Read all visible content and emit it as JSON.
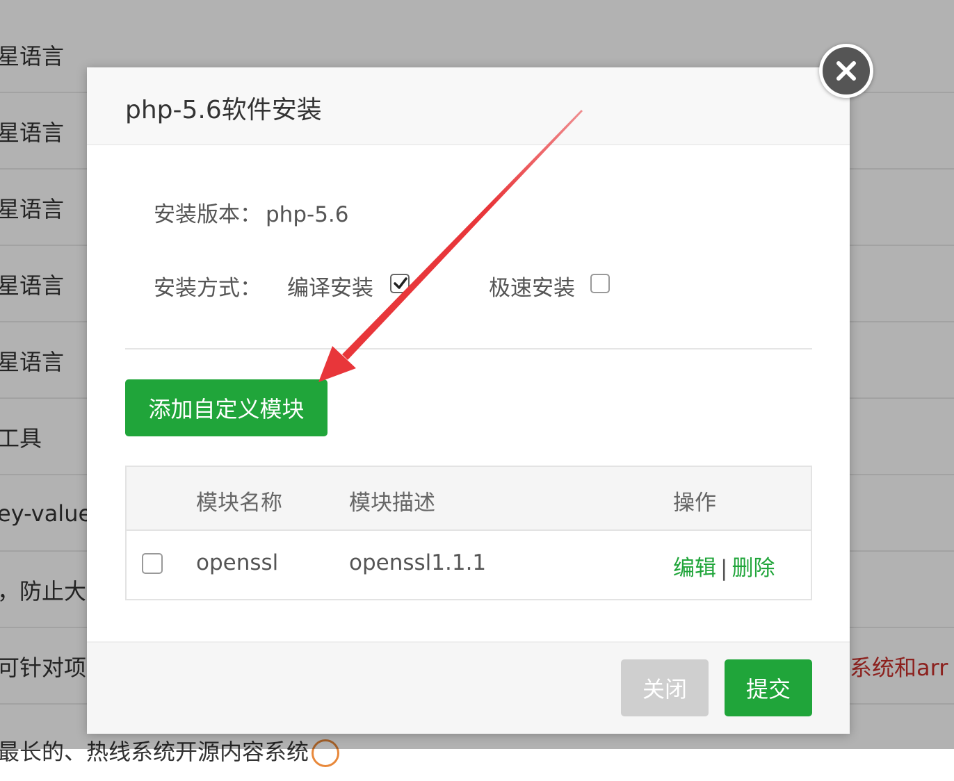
{
  "background": {
    "rows": [
      {
        "text": "星语言",
        "right": ""
      },
      {
        "text": "星语言",
        "right": ""
      },
      {
        "text": "星语言",
        "right": ""
      },
      {
        "text": "星语言",
        "right": ""
      },
      {
        "text": "星语言",
        "right": ""
      },
      {
        "text": "工具",
        "right": ""
      },
      {
        "text": "ey-value",
        "right": ""
      },
      {
        "text": "，防止大",
        "right": ""
      },
      {
        "text": "可针对项目",
        "right": "系统和arr"
      },
      {
        "text": "最长的、热线系统开源内容系统",
        "right": ""
      }
    ]
  },
  "modal": {
    "title": "php-5.6软件安装",
    "version_label": "安装版本：",
    "version_value": "php-5.6",
    "method_label": "安装方式：",
    "option_compile": "编译安装",
    "option_compile_checked": true,
    "option_fast": "极速安装",
    "option_fast_checked": false,
    "add_module_button": "添加自定义模块",
    "table": {
      "headers": [
        "模块名称",
        "模块描述",
        "操作"
      ],
      "rows": [
        {
          "name": "openssl",
          "description": "openssl1.1.1",
          "edit": "编辑",
          "separator": "|",
          "delete": "删除",
          "checked": false
        }
      ]
    },
    "footer": {
      "close_label": "关闭",
      "submit_label": "提交"
    }
  },
  "colors": {
    "accent": "#20a53a",
    "annotation_arrow": "#e8363a"
  },
  "icons": {
    "close": "close-icon",
    "check": "check-icon",
    "annotation": "arrow-annotation"
  }
}
